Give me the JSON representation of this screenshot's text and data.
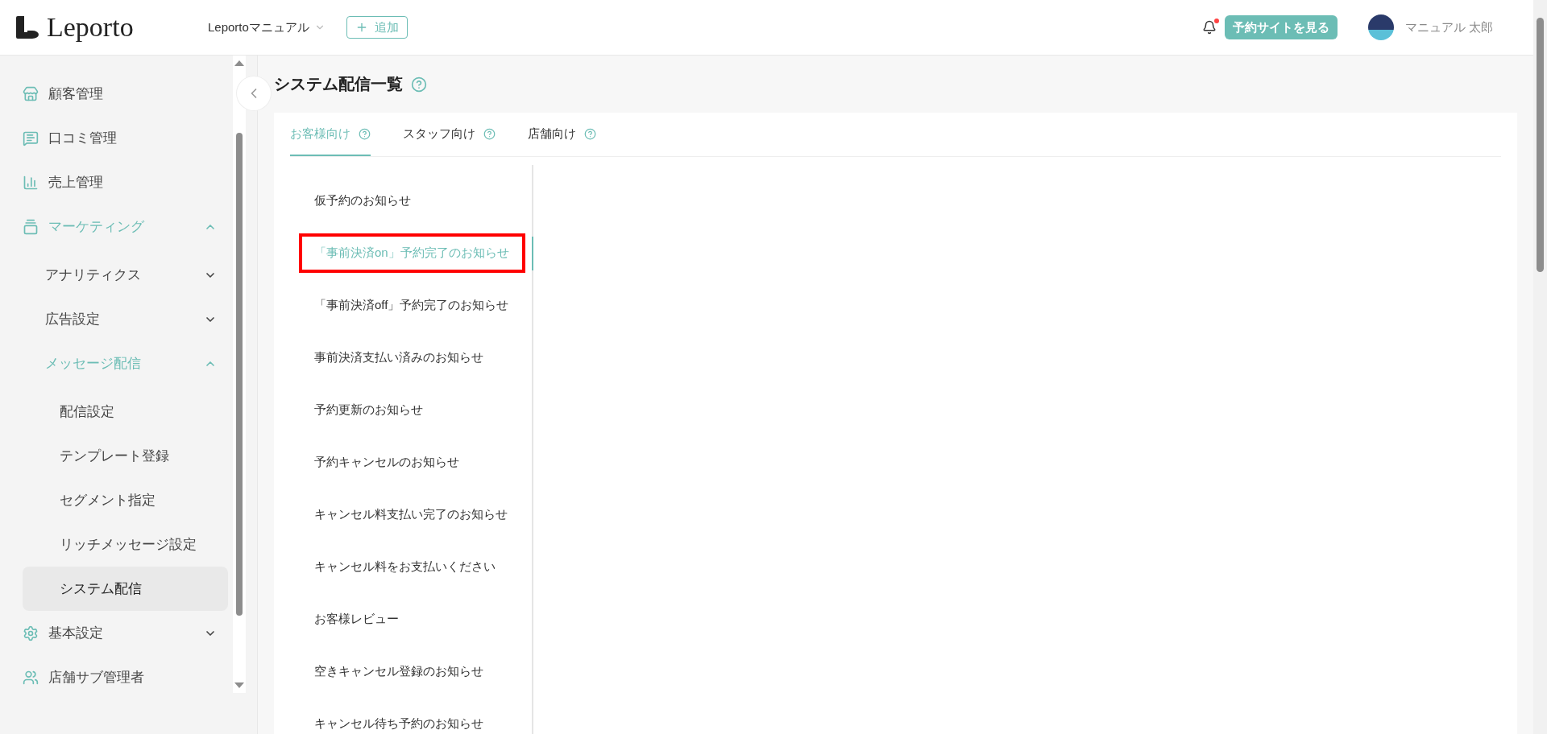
{
  "header": {
    "logo": "Leporto",
    "store_selector": "Leportoマニュアル",
    "add_button": "追加",
    "notification": {
      "unread": true
    },
    "site_button": "予約サイトを見る",
    "user_name": "マニュアル 太郎"
  },
  "sidebar": {
    "items": [
      {
        "label": "顧客管理",
        "selected": false
      },
      {
        "label": "口コミ管理",
        "selected": false
      },
      {
        "label": "売上管理",
        "selected": false
      },
      {
        "label": "マーケティング",
        "expanded": true,
        "children": [
          {
            "label": "アナリティクス",
            "expanded": false
          },
          {
            "label": "広告設定",
            "expanded": false
          },
          {
            "label": "メッセージ配信",
            "expanded": true,
            "children": [
              {
                "label": "配信設定",
                "selected": false
              },
              {
                "label": "テンプレート登録",
                "selected": false
              },
              {
                "label": "セグメント指定",
                "selected": false
              },
              {
                "label": "リッチメッセージ設定",
                "selected": false
              },
              {
                "label": "システム配信",
                "selected": true
              }
            ]
          }
        ]
      },
      {
        "label": "基本設定",
        "expanded": false
      },
      {
        "label": "店舗サブ管理者",
        "selected": false
      }
    ]
  },
  "page": {
    "title": "システム配信一覧",
    "tabs": [
      {
        "label": "お客様向け",
        "selected": true
      },
      {
        "label": "スタッフ向け",
        "selected": false
      },
      {
        "label": "店舗向け",
        "selected": false
      }
    ],
    "messages": [
      {
        "label": "仮予約のお知らせ",
        "selected": false,
        "highlighted": false
      },
      {
        "label": "「事前決済on」予約完了のお知らせ",
        "selected": true,
        "highlighted": true
      },
      {
        "label": "「事前決済off」予約完了のお知らせ",
        "selected": false,
        "highlighted": false
      },
      {
        "label": "事前決済支払い済みのお知らせ",
        "selected": false,
        "highlighted": false
      },
      {
        "label": "予約更新のお知らせ",
        "selected": false,
        "highlighted": false
      },
      {
        "label": "予約キャンセルのお知らせ",
        "selected": false,
        "highlighted": false
      },
      {
        "label": "キャンセル料支払い完了のお知らせ",
        "selected": false,
        "highlighted": false
      },
      {
        "label": "キャンセル料をお支払いください",
        "selected": false,
        "highlighted": false
      },
      {
        "label": "お客様レビュー",
        "selected": false,
        "highlighted": false
      },
      {
        "label": "空きキャンセル登録のお知らせ",
        "selected": false,
        "highlighted": false
      },
      {
        "label": "キャンセル待ち予約のお知らせ",
        "selected": false,
        "highlighted": false
      }
    ]
  }
}
